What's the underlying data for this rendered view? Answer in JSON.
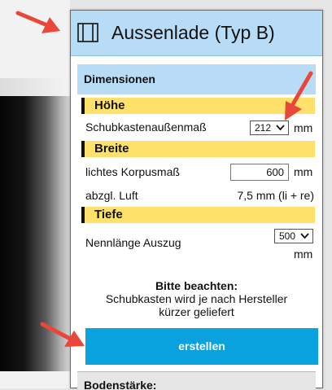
{
  "panel": {
    "title": "Aussenlade (Typ B)",
    "icon": "drawer-icon"
  },
  "section": {
    "title": "Dimensionen"
  },
  "hoehe": {
    "heading": "Höhe",
    "label": "Schubkastenaußenmaß",
    "select_value": "212",
    "unit": "mm"
  },
  "breite": {
    "heading": "Breite",
    "label": "lichtes Korpusmaß",
    "input_value": "600",
    "unit": "mm",
    "luft_label": "abzgl. Luft",
    "luft_value": "7,5 mm (li + re)"
  },
  "tiefe": {
    "heading": "Tiefe",
    "label": "Nennlänge Auszug",
    "select_value": "500",
    "unit": "mm"
  },
  "notice": {
    "heading": "Bitte beachten:",
    "line1": "Schubkasten wird je nach Hersteller",
    "line2": "kürzer geliefert"
  },
  "create_button": {
    "label": "erstellen"
  },
  "next_section": {
    "title": "Bodenstärke:"
  },
  "colors": {
    "header_bg": "#b9dcf6",
    "subheading_bg": "#fde16b",
    "button_bg": "#0aa1df",
    "arrow": "#e8473a"
  }
}
